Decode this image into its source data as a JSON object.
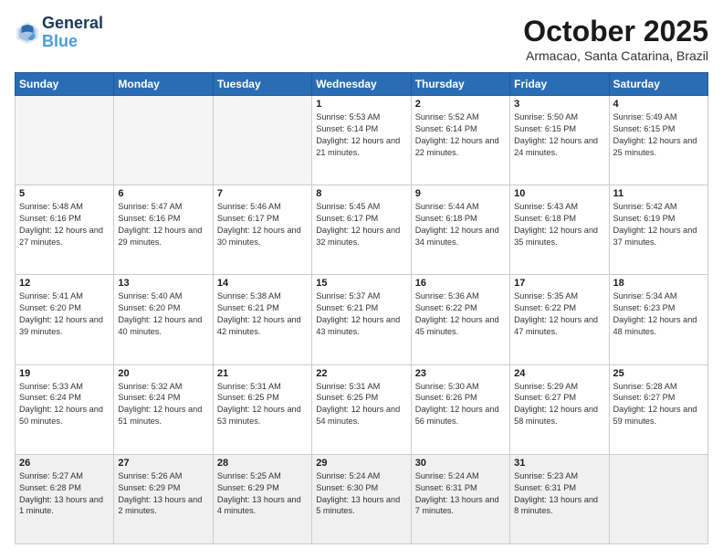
{
  "header": {
    "logo_line1": "General",
    "logo_line2": "Blue",
    "month": "October 2025",
    "location": "Armacao, Santa Catarina, Brazil"
  },
  "weekdays": [
    "Sunday",
    "Monday",
    "Tuesday",
    "Wednesday",
    "Thursday",
    "Friday",
    "Saturday"
  ],
  "weeks": [
    [
      {
        "day": "",
        "empty": true
      },
      {
        "day": "",
        "empty": true
      },
      {
        "day": "",
        "empty": true
      },
      {
        "day": "1",
        "sunrise": "5:53 AM",
        "sunset": "6:14 PM",
        "daylight": "12 hours and 21 minutes."
      },
      {
        "day": "2",
        "sunrise": "5:52 AM",
        "sunset": "6:14 PM",
        "daylight": "12 hours and 22 minutes."
      },
      {
        "day": "3",
        "sunrise": "5:50 AM",
        "sunset": "6:15 PM",
        "daylight": "12 hours and 24 minutes."
      },
      {
        "day": "4",
        "sunrise": "5:49 AM",
        "sunset": "6:15 PM",
        "daylight": "12 hours and 25 minutes."
      }
    ],
    [
      {
        "day": "5",
        "sunrise": "5:48 AM",
        "sunset": "6:16 PM",
        "daylight": "12 hours and 27 minutes."
      },
      {
        "day": "6",
        "sunrise": "5:47 AM",
        "sunset": "6:16 PM",
        "daylight": "12 hours and 29 minutes."
      },
      {
        "day": "7",
        "sunrise": "5:46 AM",
        "sunset": "6:17 PM",
        "daylight": "12 hours and 30 minutes."
      },
      {
        "day": "8",
        "sunrise": "5:45 AM",
        "sunset": "6:17 PM",
        "daylight": "12 hours and 32 minutes."
      },
      {
        "day": "9",
        "sunrise": "5:44 AM",
        "sunset": "6:18 PM",
        "daylight": "12 hours and 34 minutes."
      },
      {
        "day": "10",
        "sunrise": "5:43 AM",
        "sunset": "6:18 PM",
        "daylight": "12 hours and 35 minutes."
      },
      {
        "day": "11",
        "sunrise": "5:42 AM",
        "sunset": "6:19 PM",
        "daylight": "12 hours and 37 minutes."
      }
    ],
    [
      {
        "day": "12",
        "sunrise": "5:41 AM",
        "sunset": "6:20 PM",
        "daylight": "12 hours and 39 minutes."
      },
      {
        "day": "13",
        "sunrise": "5:40 AM",
        "sunset": "6:20 PM",
        "daylight": "12 hours and 40 minutes."
      },
      {
        "day": "14",
        "sunrise": "5:38 AM",
        "sunset": "6:21 PM",
        "daylight": "12 hours and 42 minutes."
      },
      {
        "day": "15",
        "sunrise": "5:37 AM",
        "sunset": "6:21 PM",
        "daylight": "12 hours and 43 minutes."
      },
      {
        "day": "16",
        "sunrise": "5:36 AM",
        "sunset": "6:22 PM",
        "daylight": "12 hours and 45 minutes."
      },
      {
        "day": "17",
        "sunrise": "5:35 AM",
        "sunset": "6:22 PM",
        "daylight": "12 hours and 47 minutes."
      },
      {
        "day": "18",
        "sunrise": "5:34 AM",
        "sunset": "6:23 PM",
        "daylight": "12 hours and 48 minutes."
      }
    ],
    [
      {
        "day": "19",
        "sunrise": "5:33 AM",
        "sunset": "6:24 PM",
        "daylight": "12 hours and 50 minutes."
      },
      {
        "day": "20",
        "sunrise": "5:32 AM",
        "sunset": "6:24 PM",
        "daylight": "12 hours and 51 minutes."
      },
      {
        "day": "21",
        "sunrise": "5:31 AM",
        "sunset": "6:25 PM",
        "daylight": "12 hours and 53 minutes."
      },
      {
        "day": "22",
        "sunrise": "5:31 AM",
        "sunset": "6:25 PM",
        "daylight": "12 hours and 54 minutes."
      },
      {
        "day": "23",
        "sunrise": "5:30 AM",
        "sunset": "6:26 PM",
        "daylight": "12 hours and 56 minutes."
      },
      {
        "day": "24",
        "sunrise": "5:29 AM",
        "sunset": "6:27 PM",
        "daylight": "12 hours and 58 minutes."
      },
      {
        "day": "25",
        "sunrise": "5:28 AM",
        "sunset": "6:27 PM",
        "daylight": "12 hours and 59 minutes."
      }
    ],
    [
      {
        "day": "26",
        "sunrise": "5:27 AM",
        "sunset": "6:28 PM",
        "daylight": "13 hours and 1 minute."
      },
      {
        "day": "27",
        "sunrise": "5:26 AM",
        "sunset": "6:29 PM",
        "daylight": "13 hours and 2 minutes."
      },
      {
        "day": "28",
        "sunrise": "5:25 AM",
        "sunset": "6:29 PM",
        "daylight": "13 hours and 4 minutes."
      },
      {
        "day": "29",
        "sunrise": "5:24 AM",
        "sunset": "6:30 PM",
        "daylight": "13 hours and 5 minutes."
      },
      {
        "day": "30",
        "sunrise": "5:24 AM",
        "sunset": "6:31 PM",
        "daylight": "13 hours and 7 minutes."
      },
      {
        "day": "31",
        "sunrise": "5:23 AM",
        "sunset": "6:31 PM",
        "daylight": "13 hours and 8 minutes."
      },
      {
        "day": "",
        "empty": true
      }
    ]
  ]
}
